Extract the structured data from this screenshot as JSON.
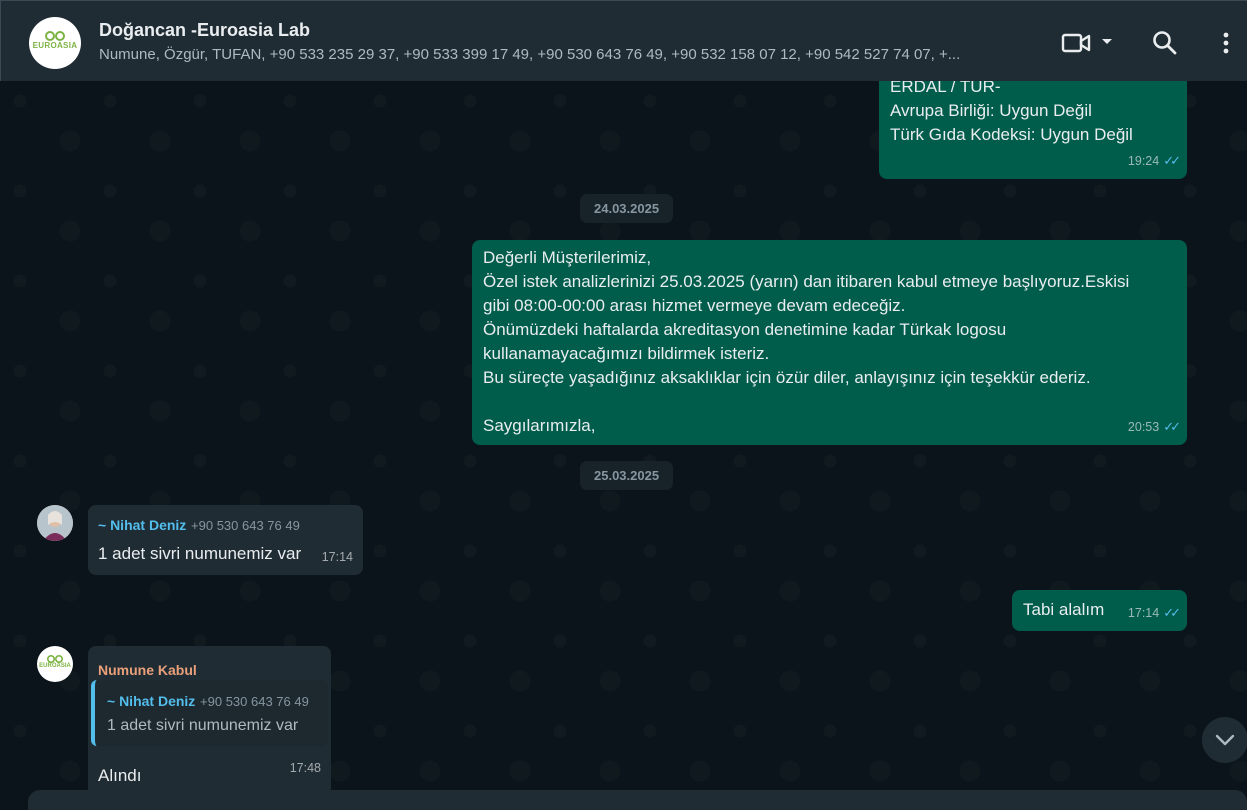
{
  "header": {
    "title": "Doğancan -Euroasia Lab",
    "subtitle": "Numune, Özgür, TUFAN, +90 533 235 29 37, +90 533 399 17 49, +90 530 643 76 49, +90 532 158 07 12, +90 542 527 74 07, +...",
    "logo_text": "EUROASIA"
  },
  "messages": {
    "m1": {
      "line1": "ERDAL / TUR-",
      "line2": "Avrupa Birliği: Uygun Değil",
      "line3": "Türk Gıda Kodeksi: Uygun Değil",
      "time": "19:24"
    },
    "date1": "24.03.2025",
    "m2": {
      "text": "Değerli Müşterilerimiz,\nÖzel istek analizlerinizi 25.03.2025 (yarın) dan itibaren kabul etmeye başlıyoruz.Eskisi\ngibi 08:00-00:00 arası hizmet vermeye devam edeceğiz.\nÖnümüzdeki haftalarda akreditasyon denetimine kadar Türkak logosu\nkullanamayacağımızı bildirmek isteriz.\nBu süreçte yaşadığınız aksaklıklar için özür diler, anlayışınız için teşekkür ederiz.\n\nSaygılarımızla,",
      "time": "20:53"
    },
    "date2": "25.03.2025",
    "m3": {
      "sender": "~ Nihat Deniz",
      "phone": "+90 530 643 76 49",
      "text": "1 adet sivri numunemiz var",
      "time": "17:14"
    },
    "m4": {
      "text": "Tabi alalım",
      "time": "17:14"
    },
    "m5": {
      "sender": "Numune Kabul",
      "quote_sender": "~ Nihat Deniz",
      "quote_phone": "+90 530 643 76 49",
      "quote_text": "1 adet sivri numunemiz var",
      "text": "Alındı",
      "time": "17:48",
      "avatar_text": "EUROASIA"
    }
  },
  "colors": {
    "outgoing": "#005c4b",
    "incoming": "#202c33",
    "sender_blue": "#53bdeb",
    "sender_orange": "#e9a07a"
  },
  "icons": [
    "video-call-icon",
    "chevron-down-icon",
    "search-icon",
    "menu-dots-icon",
    "double-check-icon",
    "scroll-down-icon"
  ]
}
